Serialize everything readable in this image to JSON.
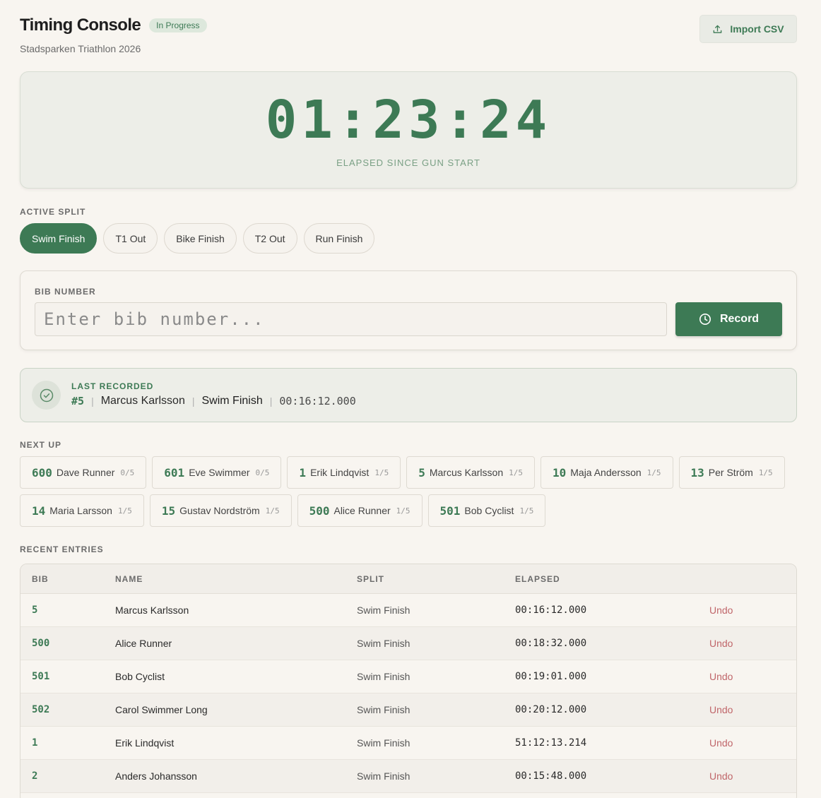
{
  "header": {
    "title": "Timing Console",
    "status": "In Progress",
    "subtitle": "Stadsparken Triathlon 2026",
    "import_label": "Import CSV"
  },
  "clock": {
    "elapsed": "01:23:24",
    "label": "ELAPSED SINCE GUN START"
  },
  "splits": {
    "label": "ACTIVE SPLIT",
    "items": [
      "Swim Finish",
      "T1 Out",
      "Bike Finish",
      "T2 Out",
      "Run Finish"
    ],
    "active": "Swim Finish"
  },
  "bib": {
    "label": "BIB NUMBER",
    "placeholder": "Enter bib number...",
    "value": "",
    "record_label": "Record"
  },
  "last_recorded": {
    "label": "LAST RECORDED",
    "bib": "#5",
    "name": "Marcus Karlsson",
    "split": "Swim Finish",
    "time": "00:16:12.000"
  },
  "next_up": {
    "label": "NEXT UP",
    "items": [
      {
        "bib": "600",
        "name": "Dave Runner",
        "progress": "0/5"
      },
      {
        "bib": "601",
        "name": "Eve Swimmer",
        "progress": "0/5"
      },
      {
        "bib": "1",
        "name": "Erik Lindqvist",
        "progress": "1/5"
      },
      {
        "bib": "5",
        "name": "Marcus Karlsson",
        "progress": "1/5"
      },
      {
        "bib": "10",
        "name": "Maja Andersson",
        "progress": "1/5"
      },
      {
        "bib": "13",
        "name": "Per Ström",
        "progress": "1/5"
      },
      {
        "bib": "14",
        "name": "Maria Larsson",
        "progress": "1/5"
      },
      {
        "bib": "15",
        "name": "Gustav Nordström",
        "progress": "1/5"
      },
      {
        "bib": "500",
        "name": "Alice Runner",
        "progress": "1/5"
      },
      {
        "bib": "501",
        "name": "Bob Cyclist",
        "progress": "1/5"
      }
    ]
  },
  "recent": {
    "label": "RECENT ENTRIES",
    "columns": [
      "BIB",
      "NAME",
      "SPLIT",
      "ELAPSED"
    ],
    "undo_label": "Undo",
    "rows": [
      {
        "bib": "5",
        "name": "Marcus Karlsson",
        "split": "Swim Finish",
        "elapsed": "00:16:12.000"
      },
      {
        "bib": "500",
        "name": "Alice Runner",
        "split": "Swim Finish",
        "elapsed": "00:18:32.000"
      },
      {
        "bib": "501",
        "name": "Bob Cyclist",
        "split": "Swim Finish",
        "elapsed": "00:19:01.000"
      },
      {
        "bib": "502",
        "name": "Carol Swimmer Long",
        "split": "Swim Finish",
        "elapsed": "00:20:12.000"
      },
      {
        "bib": "1",
        "name": "Erik Lindqvist",
        "split": "Swim Finish",
        "elapsed": "51:12:13.214"
      },
      {
        "bib": "2",
        "name": "Anders Johansson",
        "split": "Swim Finish",
        "elapsed": "00:15:48.000"
      }
    ]
  },
  "colors": {
    "accent": "#3d7a55",
    "background": "#f8f5f0",
    "undo": "#c0666a"
  },
  "icons": {
    "import": "upload-icon",
    "record": "clock-icon",
    "last": "check-circle-icon"
  }
}
